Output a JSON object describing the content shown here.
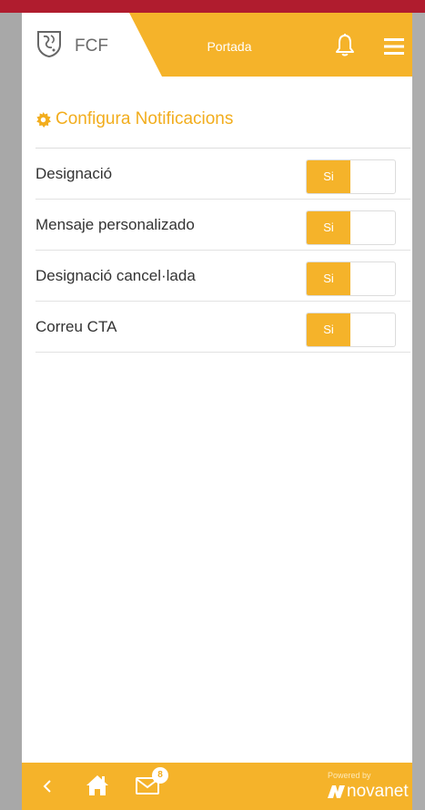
{
  "header": {
    "brand": "FCF",
    "title": "Portada",
    "logo_icon": "fcf-crest-icon",
    "bell_icon": "bell-icon",
    "menu_icon": "hamburger-menu-icon"
  },
  "settings": {
    "title": "Configura Notificacions",
    "title_icon": "gear-icon",
    "items": [
      {
        "label": "Designació",
        "toggle": "Si"
      },
      {
        "label": "Mensaje personalizado",
        "toggle": "Si"
      },
      {
        "label": "Designació cancel·lada",
        "toggle": "Si"
      },
      {
        "label": "Correu CTA",
        "toggle": "Si"
      }
    ]
  },
  "footer": {
    "back_icon": "chevron-left-icon",
    "home_icon": "home-icon",
    "mail_icon": "mail-icon",
    "mail_badge": "8",
    "powered_by": "Powered by",
    "brand": "novanet"
  },
  "colors": {
    "accent": "#f5b32a",
    "top_strip": "#b01c2e",
    "text": "#333333"
  }
}
